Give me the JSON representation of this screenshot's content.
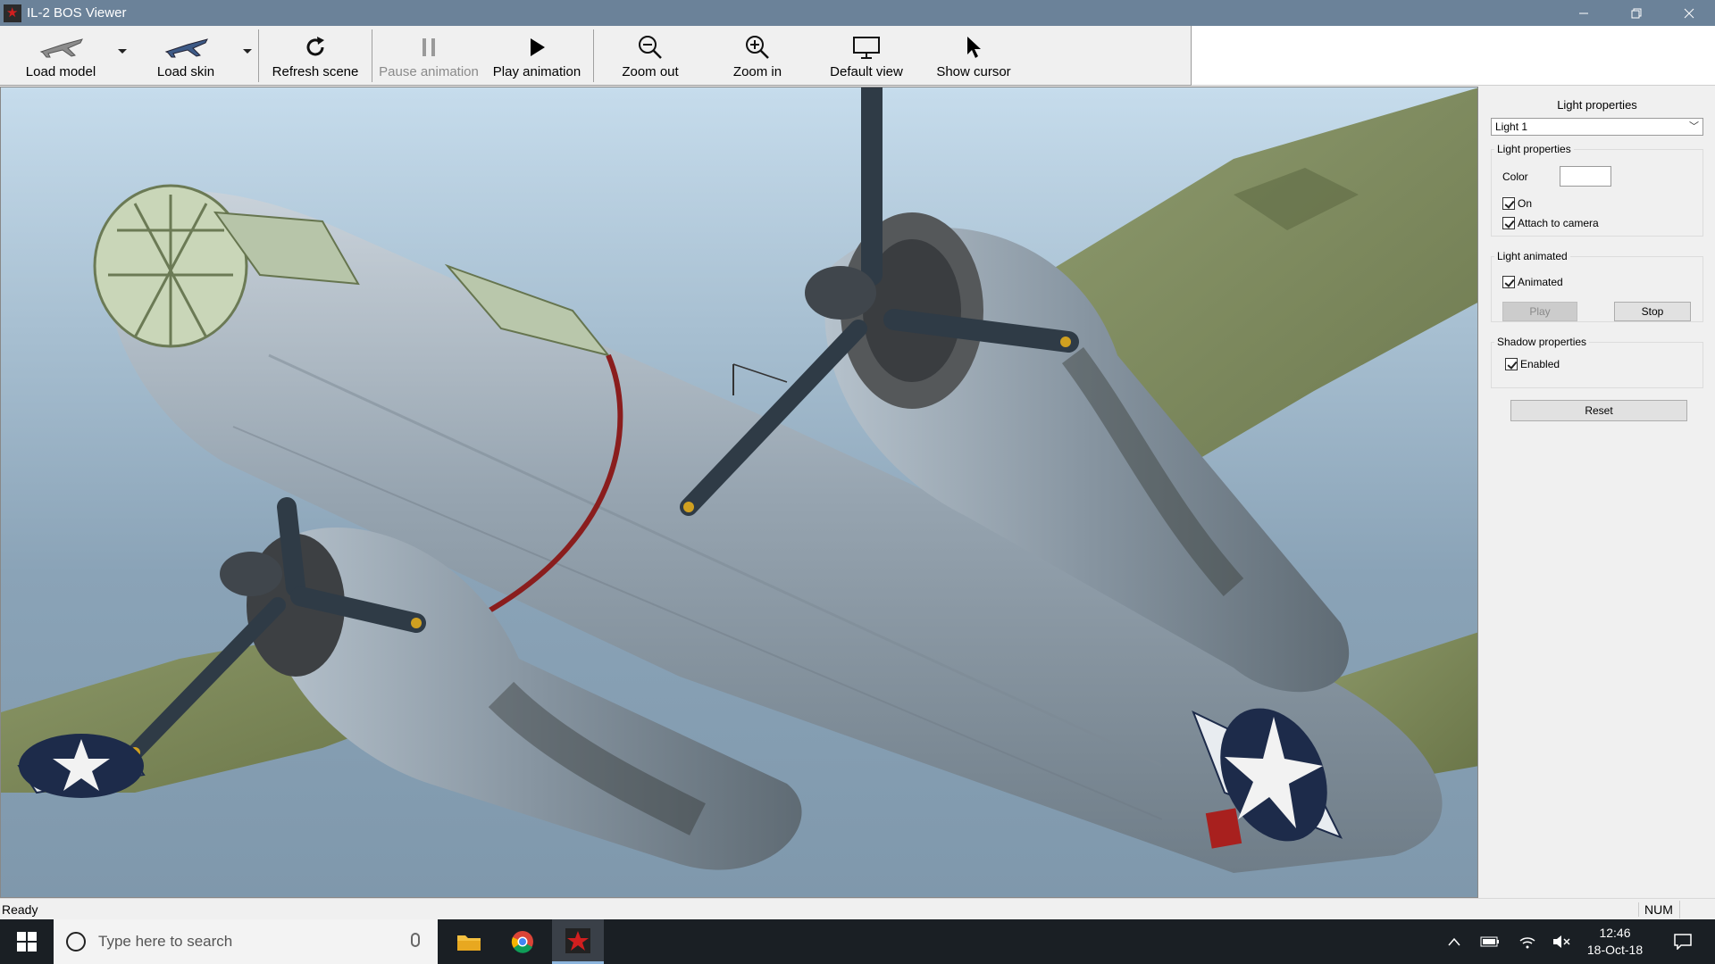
{
  "window": {
    "title": "IL-2 BOS Viewer",
    "controls": [
      "minimize",
      "restore",
      "close"
    ]
  },
  "toolbar": {
    "load_model": "Load model",
    "load_skin": "Load skin",
    "refresh_scene": "Refresh scene",
    "pause_animation": "Pause animation",
    "play_animation": "Play animation",
    "zoom_out": "Zoom out",
    "zoom_in": "Zoom in",
    "default_view": "Default view",
    "show_cursor": "Show cursor"
  },
  "panel": {
    "title": "Light properties",
    "light_select": "Light 1",
    "light_group": {
      "label": "Light properties",
      "color_label": "Color",
      "on_label": "On",
      "on_checked": true,
      "attach_label": "Attach to camera",
      "attach_checked": true
    },
    "animated_group": {
      "label": "Light animated",
      "animated_label": "Animated",
      "animated_checked": true,
      "play_label": "Play",
      "stop_label": "Stop"
    },
    "shadow_group": {
      "label": "Shadow properties",
      "enabled_label": "Enabled",
      "enabled_checked": true
    },
    "reset_label": "Reset"
  },
  "status": {
    "text": "Ready",
    "num": "NUM"
  },
  "taskbar": {
    "search_placeholder": "Type here to search",
    "time": "12:46",
    "date": "18-Oct-18"
  },
  "colors": {
    "titlebar": "#6b8299",
    "taskbar": "#1a1f24",
    "aircraft_metal": "#9aa7b3",
    "olive_drab": "#7e8a5b",
    "insignia_blue": "#1d2b4a"
  }
}
